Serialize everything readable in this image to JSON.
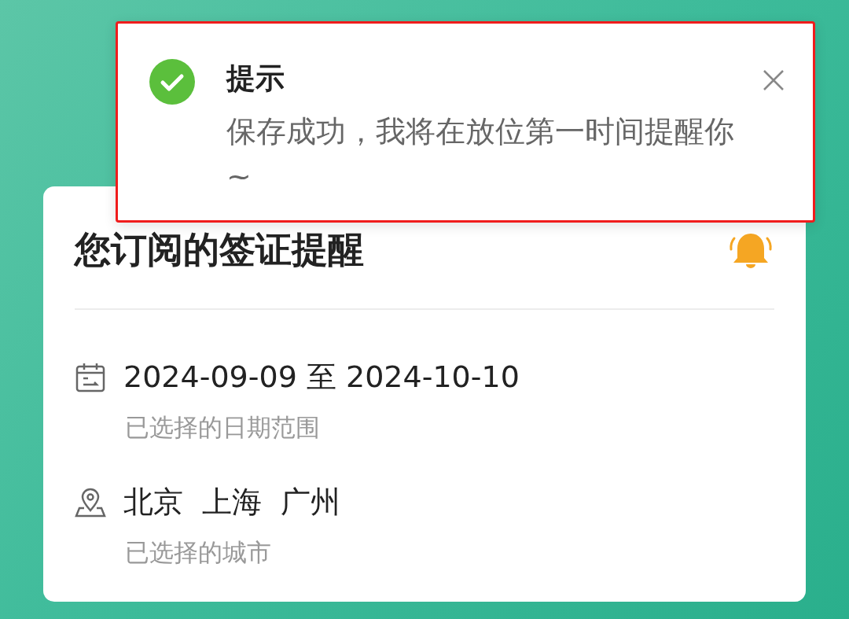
{
  "toast": {
    "kind": "success",
    "highlighted": true,
    "title": "提示",
    "message": "保存成功，我将在放位第一时间提醒你~"
  },
  "card": {
    "title": "您订阅的签证提醒",
    "rows": [
      {
        "kind": "date",
        "values": [
          "2024-09-09 至 2024-10-10"
        ],
        "caption": "已选择的日期范围"
      },
      {
        "kind": "city",
        "values": [
          "北京",
          "上海",
          "广州"
        ],
        "caption": "已选择的城市"
      }
    ]
  }
}
